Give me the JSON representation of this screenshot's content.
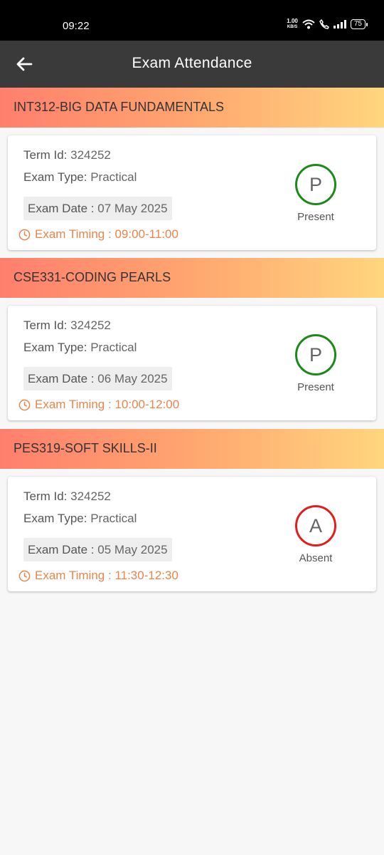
{
  "status_bar": {
    "time": "09:22",
    "net_speed_value": "1.00",
    "net_speed_unit": "KB/S",
    "battery": "75"
  },
  "app_bar": {
    "title": "Exam Attendance"
  },
  "labels": {
    "term_id": "Term Id:",
    "exam_type": "Exam Type:",
    "exam_date": "Exam Date :",
    "exam_timing": "Exam Timing :"
  },
  "colors": {
    "present": "#1a8a1a",
    "absent": "#e01e1e",
    "timing": "#e8854a",
    "app_bar": "#3a3a3a"
  },
  "exams": [
    {
      "course": "INT312-BIG DATA FUNDAMENTALS",
      "term_id": "324252",
      "exam_type": "Practical",
      "exam_date": "07 May 2025",
      "exam_timing": "09:00-11:00",
      "status_letter": "P",
      "status_label": "Present"
    },
    {
      "course": "CSE331-CODING PEARLS",
      "term_id": "324252",
      "exam_type": "Practical",
      "exam_date": "06 May 2025",
      "exam_timing": "10:00-12:00",
      "status_letter": "P",
      "status_label": "Present"
    },
    {
      "course": "PES319-SOFT SKILLS-II",
      "term_id": "324252",
      "exam_type": "Practical",
      "exam_date": "05 May 2025",
      "exam_timing": "11:30-12:30",
      "status_letter": "A",
      "status_label": "Absent"
    }
  ]
}
